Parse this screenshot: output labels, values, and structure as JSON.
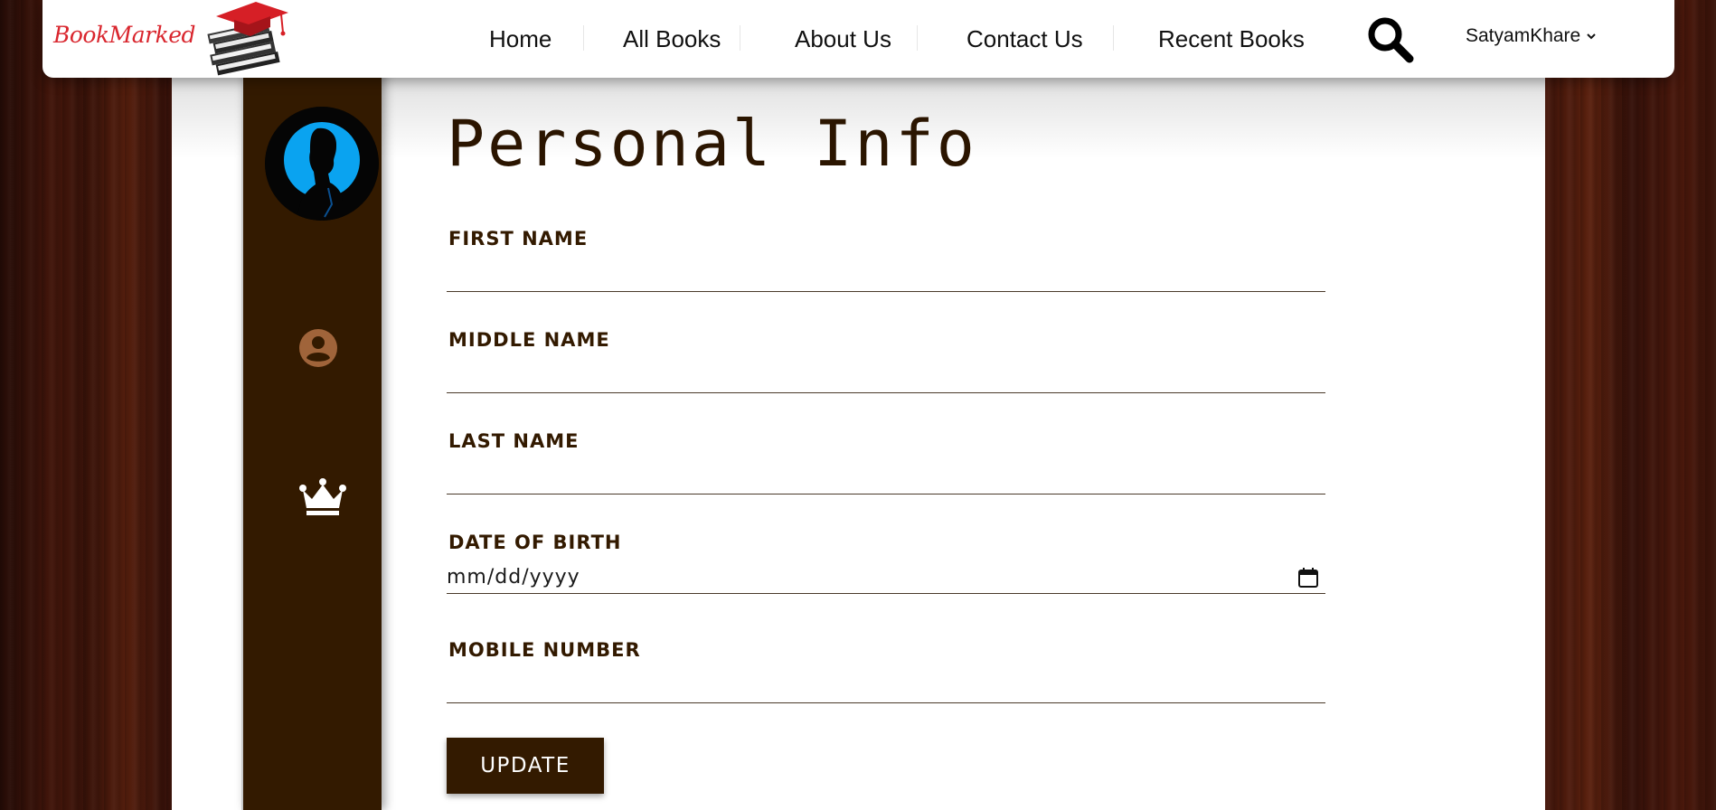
{
  "brand": {
    "name": "BookMarked",
    "logo_color": "#d9262e"
  },
  "nav": {
    "links": [
      {
        "label": "Home"
      },
      {
        "label": "All Books"
      },
      {
        "label": "About Us"
      },
      {
        "label": "Contact Us"
      },
      {
        "label": "Recent Books"
      }
    ],
    "search_icon": "search-icon",
    "user": {
      "name": "SatyamKhare",
      "dropdown_icon": "chevron-down-icon"
    }
  },
  "sidebar": {
    "avatar_icon": "user-silhouette-icon",
    "items": [
      {
        "icon": "profile-icon",
        "color": "#a0643a"
      },
      {
        "icon": "crown-icon",
        "color": "#ffffff"
      }
    ],
    "background": "#331a00"
  },
  "form": {
    "title": "Personal Info",
    "fields": [
      {
        "label": "FIRST NAME",
        "value": ""
      },
      {
        "label": "MIDDLE NAME",
        "value": ""
      },
      {
        "label": "LAST NAME",
        "value": ""
      },
      {
        "label": "DATE OF BIRTH",
        "value": "",
        "placeholder": "mm/dd/yyyy"
      },
      {
        "label": "MOBILE NUMBER",
        "value": ""
      }
    ],
    "submit_label": "UPDATE",
    "accent": "#331a00"
  }
}
